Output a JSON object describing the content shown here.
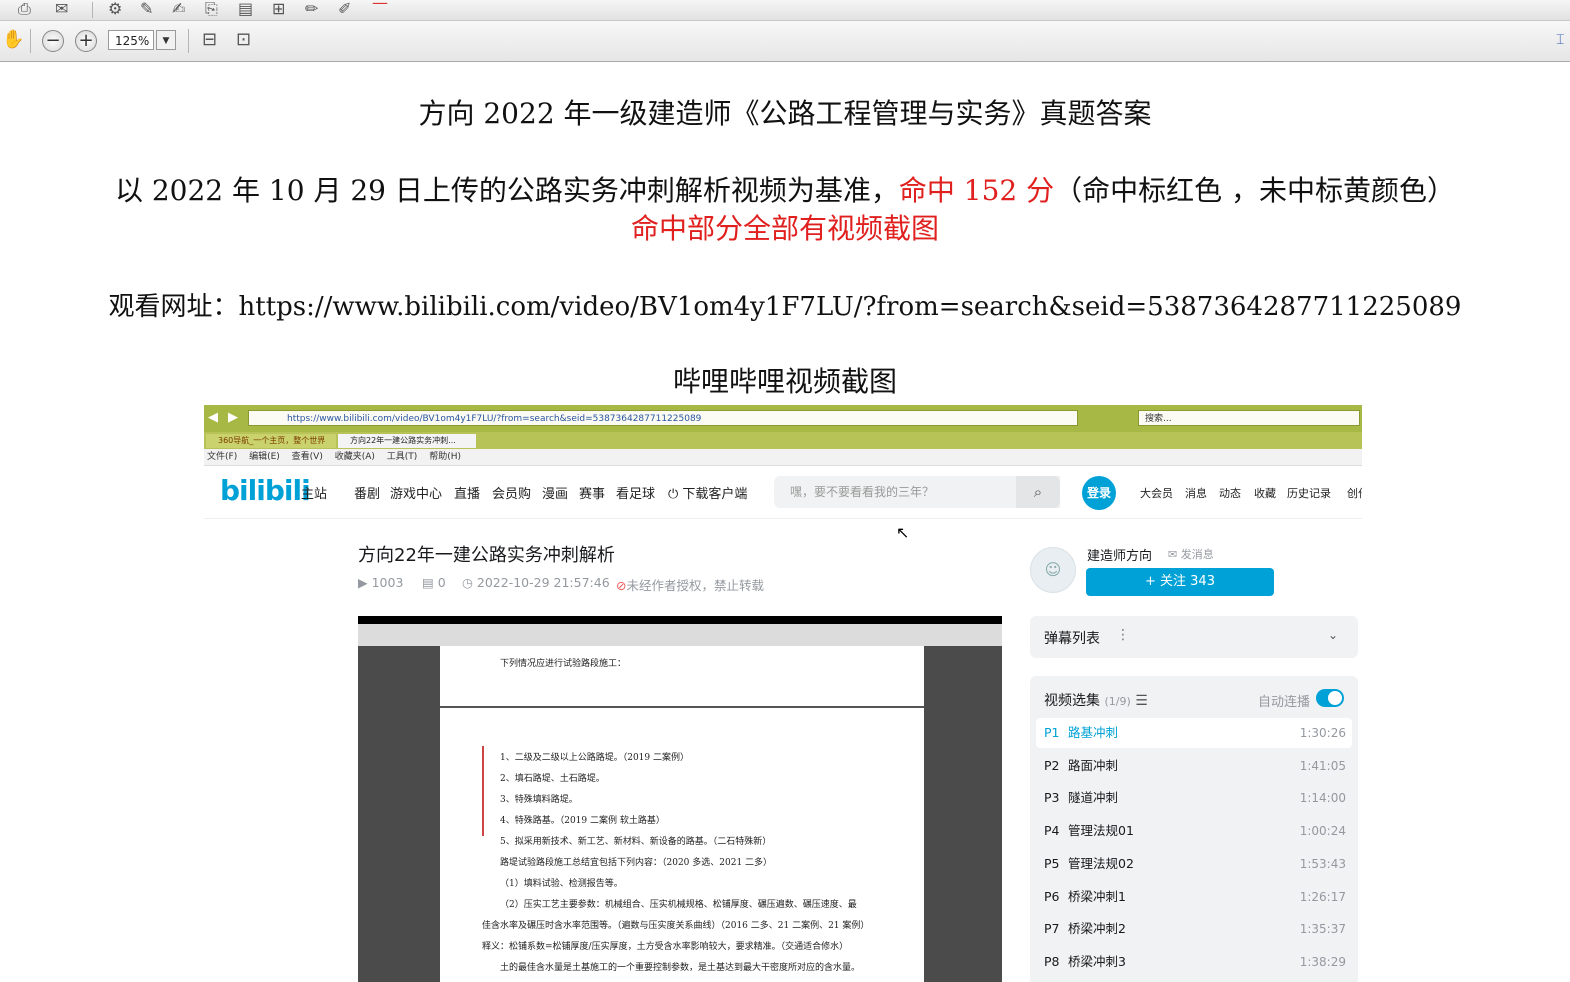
{
  "viewer": {
    "zoom": "125%"
  },
  "doc": {
    "title": "方向 2022 年一级建造师《公路工程管理与实务》真题答案",
    "line1_prefix": "以 2022 年 10 月 29 日上传的公路实务冲刺解析视频为基准，",
    "line1_red": "命中 152 分",
    "line1_suffix": "（命中标红色 ，未中标黄颜色）",
    "line2_red": "命中部分全部有视频截图",
    "url_line": "观看网址：https://www.bilibili.com/video/BV1om4y1F7LU/?from=search&seid=5387364287711225089",
    "screenshot_caption": "哔哩哔哩视频截图"
  },
  "browser": {
    "address": "https://www.bilibili.com/video/BV1om4y1F7LU/?from=search&seid=5387364287711225089",
    "search_placeholder": "搜索...",
    "tabs": [
      "360导航_一个主页，整个世界",
      "方向22年一建公路实务冲刺..."
    ],
    "menu": [
      "文件(F)",
      "编辑(E)",
      "查看(V)",
      "收藏夹(A)",
      "工具(T)",
      "帮助(H)"
    ]
  },
  "bili": {
    "logo": "bilibili",
    "nav": [
      "主站",
      "番剧",
      "游戏中心",
      "直播",
      "会员购",
      "漫画",
      "赛事",
      "看足球",
      "下载客户端"
    ],
    "search_placeholder": "嘿，要不要看看我的三年？",
    "login": "登录",
    "right_nav": [
      "大会员",
      "消息",
      "动态",
      "收藏",
      "历史记录",
      "创作"
    ],
    "video_title": "方向22年一建公路实务冲刺解析",
    "views": "1003",
    "danmaku": "0",
    "date": "2022-10-29 21:57:46",
    "copyright": "未经作者授权，禁止转载",
    "up_name": "建造师方向",
    "up_message": "发消息",
    "follow": "+ 关注 343",
    "danmu_list": "弹幕列表",
    "playlist_title": "视频选集",
    "playlist_count": "(1/9)",
    "autoplay": "自动连播",
    "episodes": [
      {
        "num": "P1",
        "name": "路基冲刺",
        "dur": "1:30:26"
      },
      {
        "num": "P2",
        "name": "路面冲刺",
        "dur": "1:41:05"
      },
      {
        "num": "P3",
        "name": "隧道冲刺",
        "dur": "1:14:00"
      },
      {
        "num": "P4",
        "name": "管理法规01",
        "dur": "1:00:24"
      },
      {
        "num": "P5",
        "name": "管理法规02",
        "dur": "1:53:43"
      },
      {
        "num": "P6",
        "name": "桥梁冲刺1",
        "dur": "1:26:17"
      },
      {
        "num": "P7",
        "name": "桥梁冲刺2",
        "dur": "1:35:37"
      },
      {
        "num": "P8",
        "name": "桥梁冲刺3",
        "dur": "1:38:29"
      }
    ],
    "video_lines": [
      "下列情况应进行试验路段施工：",
      "1、二级及二级以上公路路堤。（2019 二案例）",
      "2、填石路堤、土石路堤。",
      "3、特殊填料路堤。",
      "4、特殊路基。（2019 二案例 软土路基）",
      "5、拟采用新技术、新工艺、新材料、新设备的路基。（二石特殊新）",
      "路堤试验路段施工总结宜包括下列内容：（2020 多选、2021 二多）",
      "（1）填料试验、检测报告等。",
      "（2）压实工艺主要参数：机械组合、压实机械规格、松铺厚度、碾压遍数、碾压速度、最",
      "佳含水率及碾压时含水率范围等。（遍数与压实度关系曲线）（2016 二多、21 二案例、21 案例）",
      "释义：松铺系数=松铺厚度/压实厚度，土方受含水率影响较大，要求精准。（交通适合修水）",
      "土的最佳含水量是土基施工的一个重要控制参数，是土基达到最大干密度所对应的含水量。"
    ]
  }
}
